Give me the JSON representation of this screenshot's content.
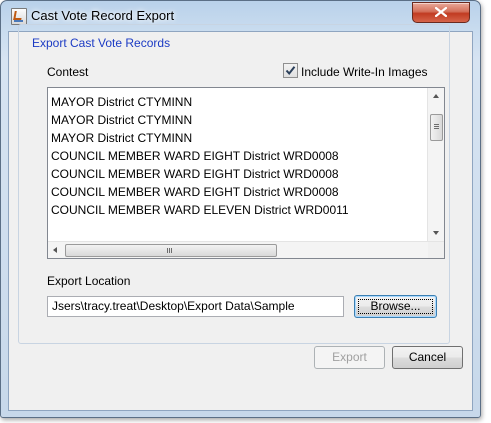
{
  "window": {
    "title": "Cast Vote Record Export",
    "icon": "java-app-icon",
    "close_icon": "close-icon"
  },
  "group": {
    "title": "Export Cast Vote Records"
  },
  "contest": {
    "label": "Contest",
    "include_write_in": {
      "label": "Include Write-In Images",
      "checked": true
    },
    "items": [
      "MAYOR District CTYMINN",
      "MAYOR District CTYMINN",
      "MAYOR District CTYMINN",
      "COUNCIL MEMBER WARD EIGHT District WRD0008",
      "COUNCIL MEMBER WARD EIGHT District WRD0008",
      "COUNCIL MEMBER WARD EIGHT District WRD0008",
      "COUNCIL MEMBER WARD ELEVEN District WRD0011"
    ]
  },
  "export_location": {
    "label": "Export Location",
    "value": "Jsers\\tracy.treat\\Desktop\\Export Data\\Sample",
    "browse_label": "Browse..."
  },
  "buttons": {
    "export_label": "Export",
    "cancel_label": "Cancel"
  }
}
